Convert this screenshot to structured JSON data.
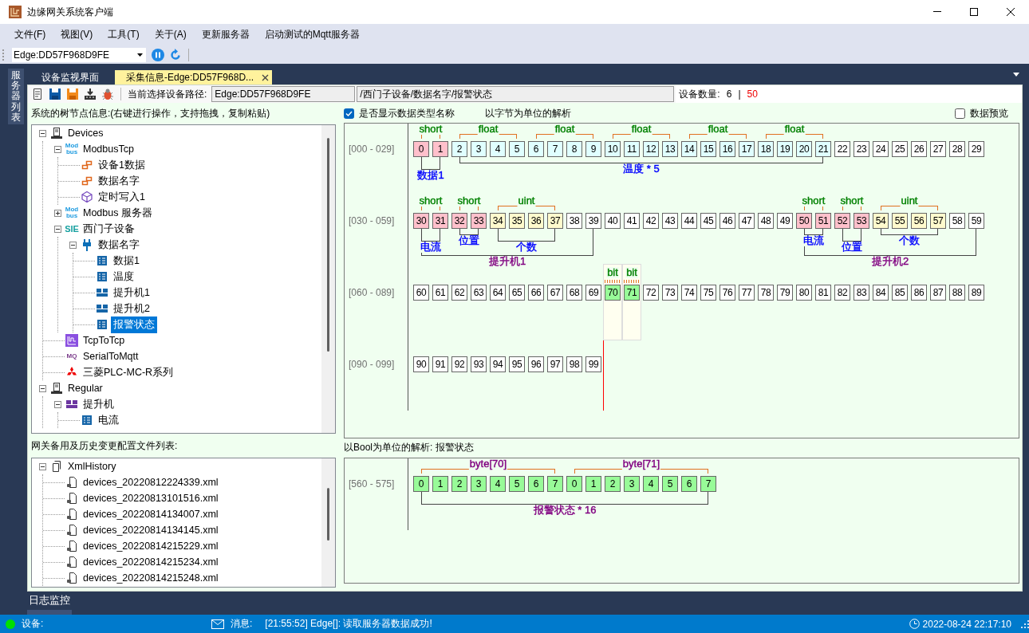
{
  "window": {
    "title": "边缘网关系统客户端"
  },
  "menu": [
    "文件(F)",
    "视图(V)",
    "工具(T)",
    "关于(A)",
    "更新服务器",
    "启动测试的Mqtt服务器"
  ],
  "toolbar": {
    "server": "Edge:DD57F968D9FE"
  },
  "side_panel": {
    "label": "服务器列表"
  },
  "tabs": [
    {
      "label": "设备监视界面",
      "selected": false
    },
    {
      "label": "采集信息-Edge:DD57F968D...",
      "selected": true
    }
  ],
  "path_bar": {
    "label": "当前选择设备路径:",
    "edge": "Edge:DD57F968D9FE",
    "path": "/西门子设备/数据名字/报警状态",
    "count_label": "设备数量:",
    "online": "6",
    "separator": "|",
    "total": "50"
  },
  "tree": {
    "title": "系统的树节点信息:(右键进行操作，支持拖拽，复制粘贴)",
    "items": [
      {
        "label": "Devices",
        "kind": "server",
        "expanded": true,
        "selected": false,
        "children": [
          {
            "label": "ModbusTcp",
            "kind": "modbus",
            "icon_lines": [
              "Mod",
              "bus"
            ],
            "expanded": true,
            "selected": false,
            "children": [
              {
                "label": "设备1数据",
                "kind": "data-block",
                "selected": false
              },
              {
                "label": "数据名字",
                "kind": "data-block",
                "selected": false
              },
              {
                "label": "定时写入1",
                "kind": "timer",
                "selected": false
              }
            ]
          },
          {
            "label": "Modbus 服务器",
            "kind": "modbus",
            "icon_lines": [
              "Mod",
              "bus"
            ],
            "expanded": false,
            "selected": false
          },
          {
            "label": "西门子设备",
            "kind": "siemens",
            "icon_lines": [
              "SIE"
            ],
            "expanded": true,
            "selected": false,
            "children": [
              {
                "label": "数据名字",
                "kind": "plug",
                "expanded": true,
                "selected": false,
                "children": [
                  {
                    "label": "数据1",
                    "kind": "register",
                    "selected": false
                  },
                  {
                    "label": "温度",
                    "kind": "register",
                    "selected": false
                  },
                  {
                    "label": "提升机1",
                    "kind": "struct",
                    "selected": false
                  },
                  {
                    "label": "提升机2",
                    "kind": "struct",
                    "selected": false
                  },
                  {
                    "label": "报警状态",
                    "kind": "register",
                    "selected": true
                  }
                ]
              }
            ]
          },
          {
            "label": "TcpToTcp",
            "kind": "tcp",
            "selected": false
          },
          {
            "label": "SerialToMqtt",
            "kind": "mqtt",
            "icon_lines": [
              "MQ"
            ],
            "selected": false
          },
          {
            "label": "三菱PLC-MC-R系列",
            "kind": "mitsubishi",
            "selected": false
          }
        ]
      },
      {
        "label": "Regular",
        "kind": "server",
        "expanded": true,
        "selected": false,
        "children": [
          {
            "label": "提升机",
            "kind": "struct-type",
            "expanded": true,
            "selected": false,
            "children": [
              {
                "label": "电流",
                "kind": "register",
                "selected": false
              }
            ]
          }
        ]
      }
    ]
  },
  "history": {
    "title": "网关备用及历史变更配置文件列表:",
    "items": [
      {
        "label": "XmlHistory",
        "kind": "document",
        "expanded": true,
        "selected": false,
        "children": [
          {
            "label": "devices_20220812224339.xml",
            "kind": "file",
            "selected": false
          },
          {
            "label": "devices_20220813101516.xml",
            "kind": "file",
            "selected": false
          },
          {
            "label": "devices_20220814134007.xml",
            "kind": "file",
            "selected": false
          },
          {
            "label": "devices_20220814134145.xml",
            "kind": "file",
            "selected": false
          },
          {
            "label": "devices_20220814215229.xml",
            "kind": "file",
            "selected": false
          },
          {
            "label": "devices_20220814215234.xml",
            "kind": "file",
            "selected": false
          },
          {
            "label": "devices_20220814215248.xml",
            "kind": "file",
            "selected": false
          }
        ]
      }
    ]
  },
  "byte_view": {
    "show_types": {
      "label": "是否显示数据类型名称",
      "checked": true
    },
    "title": "以字节为单位的解析",
    "preview": {
      "label": "数据预览",
      "checked": false
    },
    "rows": [
      {
        "range": "[000 - 029]",
        "items": [
          {
            "kind": "name",
            "label": "数据1",
            "color": "#0000ff",
            "items": [
              {
                "kind": "type",
                "label": {
                  "text": "short",
                  "color": "#008000"
                },
                "color": "#ffc0cb",
                "cells": [
                  "0",
                  "1"
                ]
              }
            ]
          },
          {
            "kind": "name",
            "label": "温度 * 5",
            "color": "#0000ff",
            "items": [
              {
                "kind": "type",
                "label": {
                  "text": "float",
                  "color": "#008000"
                },
                "color": "#e0ffff",
                "cells": [
                  "2",
                  "3",
                  "4",
                  "5"
                ]
              },
              {
                "kind": "type",
                "label": {
                  "text": "float",
                  "color": "#008000"
                },
                "color": "#e0ffff",
                "cells": [
                  "6",
                  "7",
                  "8",
                  "9"
                ]
              },
              {
                "kind": "type",
                "label": {
                  "text": "float",
                  "color": "#008000"
                },
                "color": "#e0ffff",
                "cells": [
                  "10",
                  "11",
                  "12",
                  "13"
                ]
              },
              {
                "kind": "type",
                "label": {
                  "text": "float",
                  "color": "#008000"
                },
                "color": "#e0ffff",
                "cells": [
                  "14",
                  "15",
                  "16",
                  "17"
                ]
              },
              {
                "kind": "type",
                "label": {
                  "text": "float",
                  "color": "#008000"
                },
                "color": "#e0ffff",
                "cells": [
                  "18",
                  "19",
                  "20",
                  "21"
                ]
              }
            ]
          },
          {
            "kind": "plain",
            "cells": [
              "22",
              "23",
              "24",
              "25",
              "26",
              "27",
              "28",
              "29"
            ]
          }
        ]
      },
      {
        "range": "[030 - 059]",
        "items": [
          {
            "kind": "name",
            "label": "提升机1",
            "color": "#800080",
            "items": [
              {
                "kind": "name",
                "label": "电流",
                "color": "#0000ff",
                "items": [
                  {
                    "kind": "type",
                    "label": {
                      "text": "short",
                      "color": "#008000"
                    },
                    "color": "#ffc0cb",
                    "cells": [
                      "30",
                      "31"
                    ]
                  }
                ]
              },
              {
                "kind": "name",
                "label": "位置",
                "color": "#0000ff",
                "items": [
                  {
                    "kind": "type",
                    "label": {
                      "text": "short",
                      "color": "#008000"
                    },
                    "color": "#ffc0cb",
                    "cells": [
                      "32",
                      "33"
                    ]
                  }
                ]
              },
              {
                "kind": "name",
                "label": "个数",
                "color": "#0000ff",
                "items": [
                  {
                    "kind": "type",
                    "label": {
                      "text": "uint",
                      "color": "#008000"
                    },
                    "color": "#fffacd",
                    "cells": [
                      "34",
                      "35",
                      "36",
                      "37"
                    ]
                  }
                ]
              },
              {
                "kind": "plain",
                "cells": [
                  "38",
                  "39"
                ]
              }
            ]
          },
          {
            "kind": "plain",
            "cells": [
              "40",
              "41",
              "42",
              "43",
              "44",
              "45",
              "46",
              "47",
              "48",
              "49"
            ]
          },
          {
            "kind": "name",
            "label": "提升机2",
            "color": "#800080",
            "items": [
              {
                "kind": "name",
                "label": "电流",
                "color": "#0000ff",
                "items": [
                  {
                    "kind": "type",
                    "label": {
                      "text": "short",
                      "color": "#008000"
                    },
                    "color": "#ffc0cb",
                    "cells": [
                      "50",
                      "51"
                    ]
                  }
                ]
              },
              {
                "kind": "name",
                "label": "位置",
                "color": "#0000ff",
                "items": [
                  {
                    "kind": "type",
                    "label": {
                      "text": "short",
                      "color": "#008000"
                    },
                    "color": "#ffc0cb",
                    "cells": [
                      "52",
                      "53"
                    ]
                  }
                ]
              },
              {
                "kind": "name",
                "label": "个数",
                "color": "#0000ff",
                "items": [
                  {
                    "kind": "type",
                    "label": {
                      "text": "uint",
                      "color": "#008000"
                    },
                    "color": "#fffacd",
                    "cells": [
                      "54",
                      "55",
                      "56",
                      "57"
                    ]
                  }
                ]
              },
              {
                "kind": "plain",
                "cells": [
                  "58",
                  "59"
                ]
              }
            ]
          }
        ]
      },
      {
        "range": "[060 - 089]",
        "items": [
          {
            "kind": "plain",
            "cells": [
              "60",
              "61",
              "62",
              "63",
              "64",
              "65",
              "66",
              "67",
              "68",
              "69"
            ]
          },
          {
            "kind": "bit",
            "label": {
              "text": "bit",
              "color": "#008000"
            },
            "color": "#98fb98",
            "cells": [
              "70"
            ]
          },
          {
            "kind": "bit",
            "label": {
              "text": "bit",
              "color": "#008000"
            },
            "color": "#98fb98",
            "cells": [
              "71"
            ]
          },
          {
            "kind": "plain",
            "cells": [
              "72",
              "73",
              "74",
              "75",
              "76",
              "77",
              "78",
              "79",
              "80",
              "81",
              "82",
              "83",
              "84",
              "85",
              "86",
              "87",
              "88",
              "89"
            ]
          }
        ]
      },
      {
        "range": "[090 - 099]",
        "items": [
          {
            "kind": "plain",
            "cells": [
              "90",
              "91",
              "92",
              "93",
              "94",
              "95",
              "96",
              "97",
              "98",
              "99"
            ]
          }
        ]
      }
    ]
  },
  "bool_view": {
    "title": "以Bool为单位的解析: 报警状态",
    "rows": [
      {
        "range": "[560 - 575]",
        "items": [
          {
            "kind": "name",
            "label": "报警状态 * 16",
            "color": "#800080",
            "items": [
              {
                "kind": "type",
                "label": {
                  "text": "byte[70]",
                  "color": "#800080"
                },
                "color": "#98fb98",
                "cells": [
                  "0",
                  "1",
                  "2",
                  "3",
                  "4",
                  "5",
                  "6",
                  "7"
                ]
              },
              {
                "kind": "type",
                "label": {
                  "text": "byte[71]",
                  "color": "#800080"
                },
                "color": "#98fb98",
                "cells": [
                  "0",
                  "1",
                  "2",
                  "3",
                  "4",
                  "5",
                  "6",
                  "7"
                ]
              }
            ]
          }
        ]
      }
    ]
  },
  "log_tab": {
    "label": "日志监控"
  },
  "status_bar": {
    "device_label": "设备:",
    "online": true,
    "message_label": "消息:",
    "message": "[21:55:52] Edge[]: 读取服务器数据成功!",
    "time": "2022-08-24 22:17:10"
  }
}
